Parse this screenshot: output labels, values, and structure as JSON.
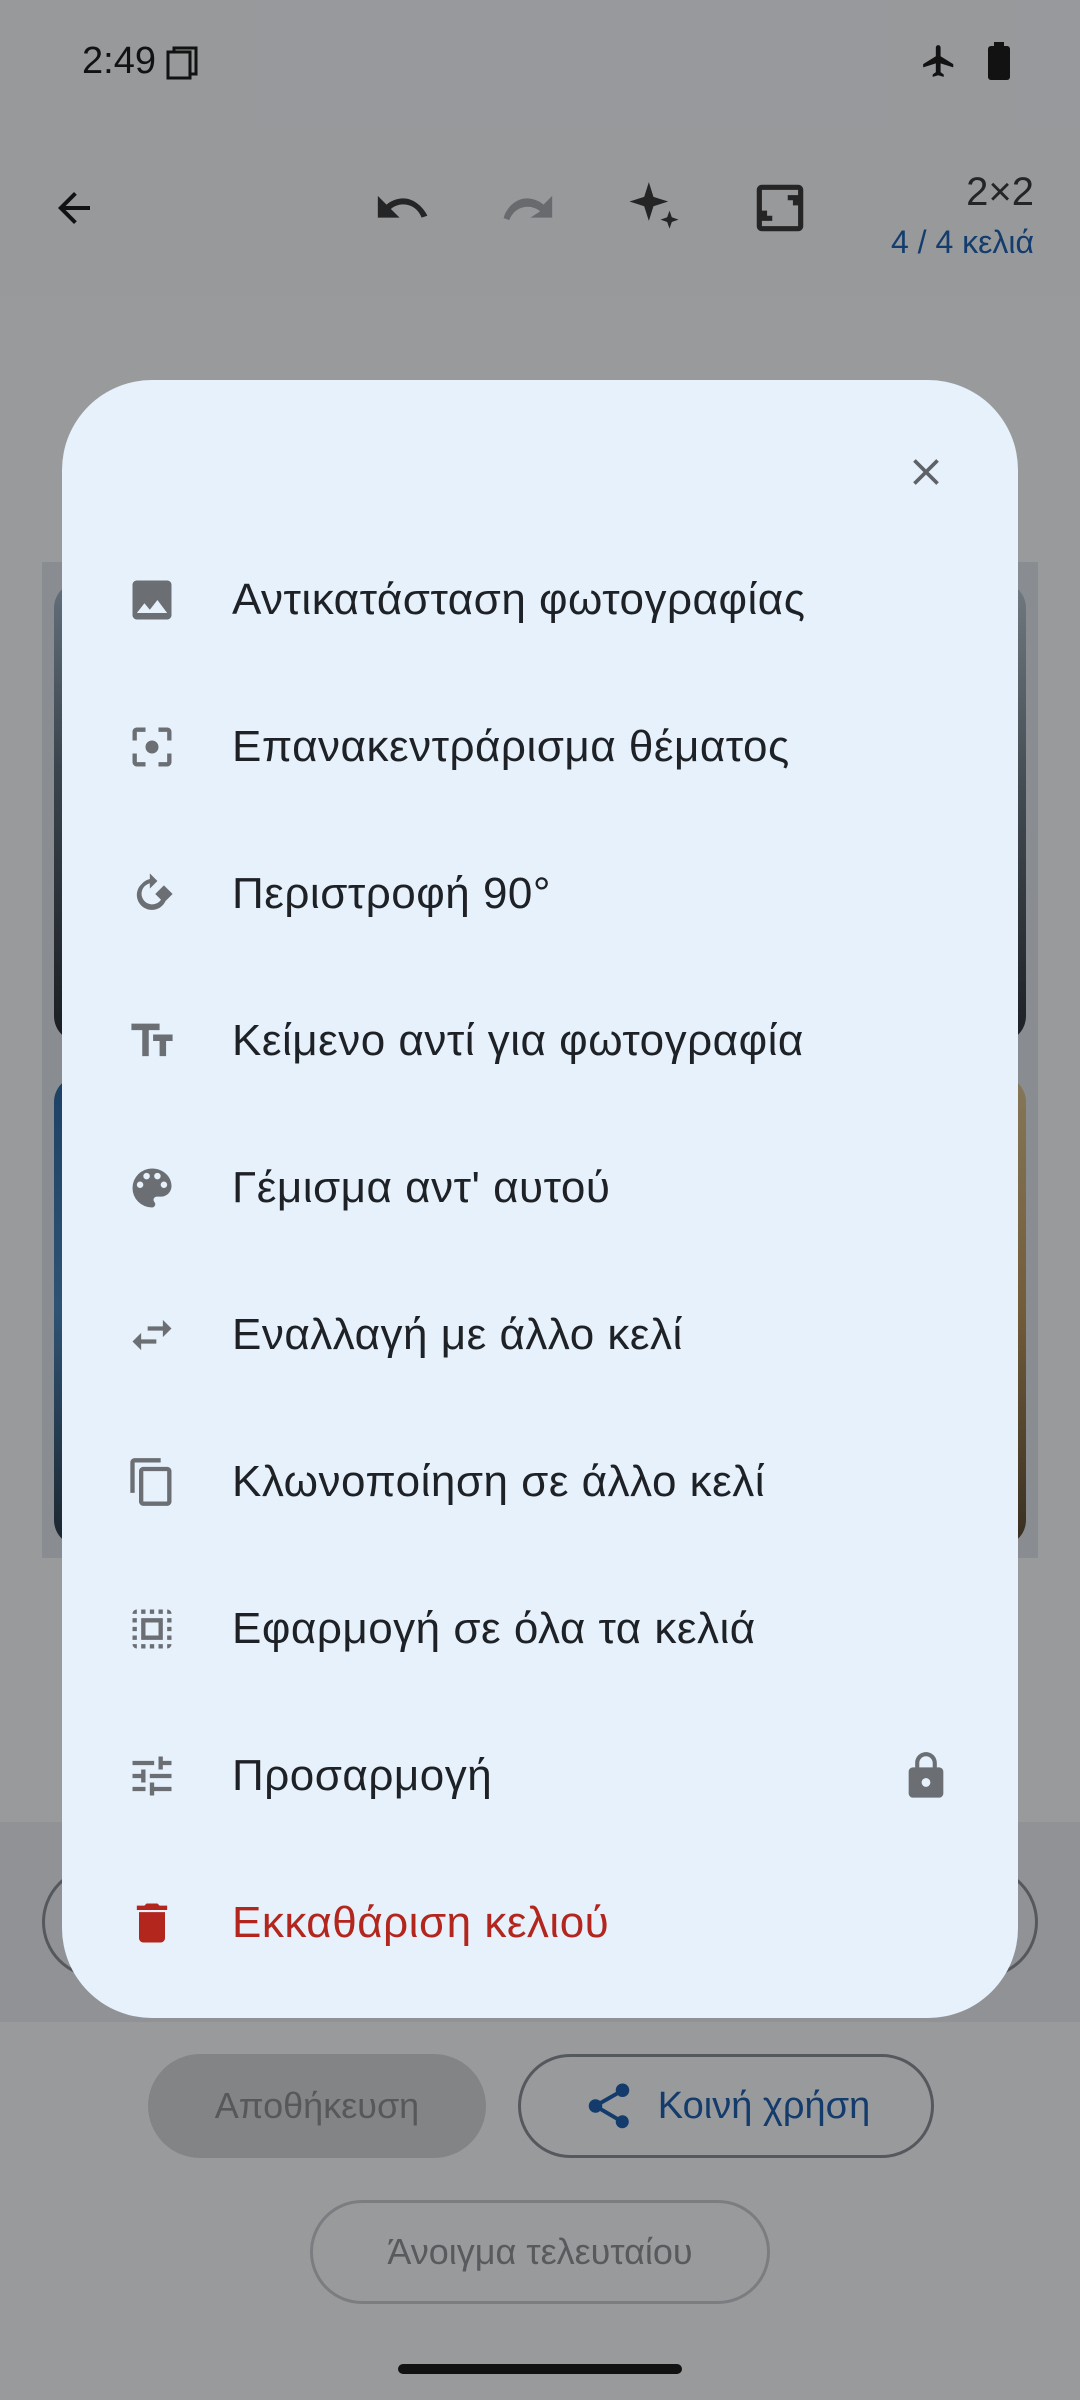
{
  "status": {
    "time": "2:49"
  },
  "toolbar": {
    "grid_size": "2×2",
    "cell_count": "4 / 4 κελιά"
  },
  "bottom": {
    "save_label": "Αποθήκευση",
    "share_label": "Κοινή χρήση",
    "open_last_label": "Άνοιγμα τελευταίου"
  },
  "dialog": {
    "items": [
      {
        "label": "Αντικατάσταση φωτογραφίας",
        "icon": "image-icon"
      },
      {
        "label": "Επανακεντράρισμα θέματος",
        "icon": "center-focus-icon"
      },
      {
        "label": "Περιστροφή 90°",
        "icon": "rotate-icon"
      },
      {
        "label": "Κείμενο αντί για φωτογραφία",
        "icon": "text-fields-icon"
      },
      {
        "label": "Γέμισμα αντ' αυτού",
        "icon": "palette-icon"
      },
      {
        "label": "Εναλλαγή με άλλο κελί",
        "icon": "swap-icon"
      },
      {
        "label": "Κλωνοποίηση σε άλλο κελί",
        "icon": "copy-icon"
      },
      {
        "label": "Εφαρμογή σε όλα τα κελιά",
        "icon": "select-all-icon"
      },
      {
        "label": "Προσαρμογή",
        "icon": "tune-icon",
        "locked": true
      },
      {
        "label": "Εκκαθάριση κελιού",
        "icon": "delete-icon",
        "danger": true
      }
    ]
  },
  "colors": {
    "dialog_bg": "#e6f1fb",
    "accent": "#1f5fae",
    "danger": "#b3261e",
    "icon": "#6b6f74"
  }
}
